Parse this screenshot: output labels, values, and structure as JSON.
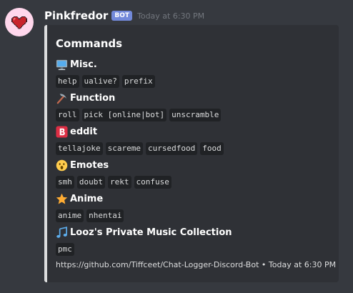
{
  "message": {
    "author": "Pinkfredor",
    "bot_tag": "BOT",
    "timestamp": "Today at 6:30 PM",
    "avatar_icon": "pink-heart-icon"
  },
  "embed": {
    "accent_color": "#dcddde",
    "title": "Commands",
    "fields": [
      {
        "icon": "computer-icon",
        "name": "Misc.",
        "commands": [
          "help",
          "ualive?",
          "prefix"
        ]
      },
      {
        "icon": "pick-icon",
        "name": "Function",
        "commands": [
          "roll",
          "pick [online|bot]",
          "unscramble"
        ]
      },
      {
        "icon": "b-button-icon",
        "name": "eddit",
        "commands": [
          "tellajoke",
          "scareme",
          "cursedfood",
          "food"
        ]
      },
      {
        "icon": "surprised-face-icon",
        "name": "Emotes",
        "commands": [
          "smh",
          "doubt",
          "rekt",
          "confuse"
        ]
      },
      {
        "icon": "star-icon",
        "name": "Anime",
        "commands": [
          "anime",
          "nhentai"
        ]
      },
      {
        "icon": "music-notes-icon",
        "name": "Looz's Private Music Collection",
        "commands": [
          "pmc"
        ]
      }
    ],
    "footer": {
      "url": "https://github.com/Tiffceet/Chat-Logger-Discord-Bot",
      "separator": "•",
      "timestamp": "Today at 6:30 PM"
    }
  },
  "colors": {
    "background": "#36393f",
    "embed_background": "#2f3136",
    "bot_tag": "#7289da",
    "code_background": "#202225"
  }
}
